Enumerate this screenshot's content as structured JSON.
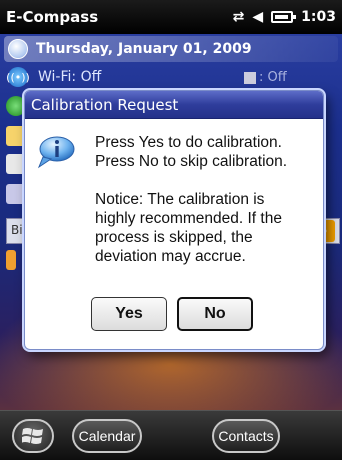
{
  "statusbar": {
    "app_title": "E-Compass",
    "time": "1:03"
  },
  "today": {
    "date": "Thursday, January 01, 2009",
    "wifi": "Wi-Fi: Off",
    "bluetooth": ": Off",
    "search_stub": "Bi"
  },
  "dialog": {
    "title": "Calibration Request",
    "line1": "Press Yes to do calibration.\nPress No to skip calibration.",
    "line2": "Notice: The calibration is\nhighly recommended. If the\nprocess is skipped, the\ndeviation may accrue.",
    "yes_label": "Yes",
    "no_label": "No"
  },
  "bottombar": {
    "left_softkey": "Calendar",
    "right_softkey": "Contacts"
  },
  "colors": {
    "title_bar": "#2f3d9c",
    "wallpaper": "#1b2f8e"
  }
}
